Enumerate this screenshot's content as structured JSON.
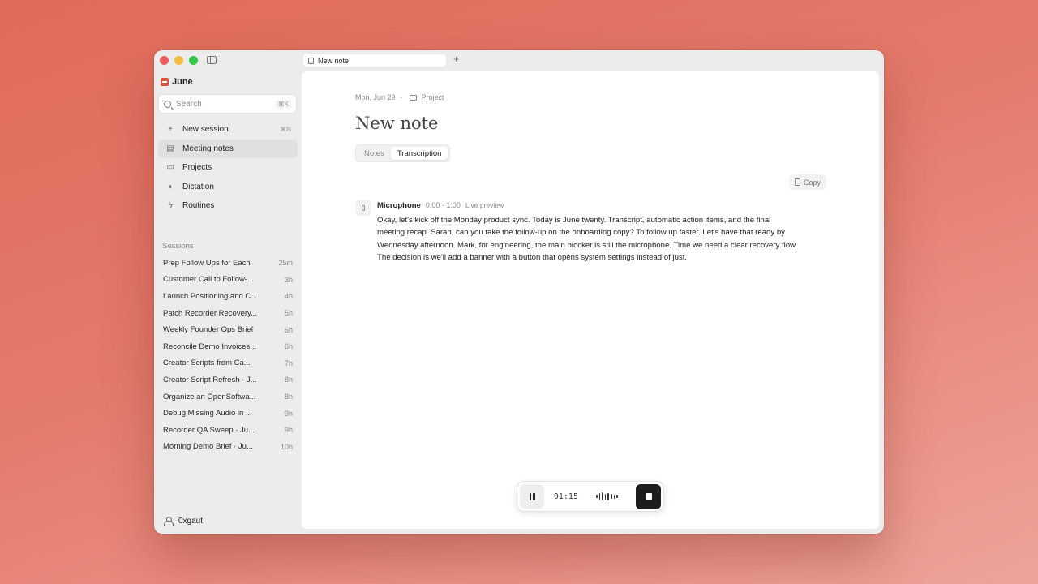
{
  "app": {
    "name": "June"
  },
  "tabs": [
    {
      "label": "New note"
    }
  ],
  "search": {
    "placeholder": "Search",
    "shortcut": "⌘K"
  },
  "nav": [
    {
      "label": "New session",
      "icon": "plus-icon",
      "shortcut": "⌘N",
      "active": false
    },
    {
      "label": "Meeting notes",
      "icon": "notes-icon",
      "active": true
    },
    {
      "label": "Projects",
      "icon": "folder-icon",
      "active": false
    },
    {
      "label": "Dictation",
      "icon": "mic-icon",
      "active": false
    },
    {
      "label": "Routines",
      "icon": "bolt-icon",
      "active": false
    }
  ],
  "sessions": {
    "label": "Sessions",
    "items": [
      {
        "title": "Prep Follow Ups for Each",
        "time": "25m"
      },
      {
        "title": "Customer Call to Follow-...",
        "time": "3h"
      },
      {
        "title": "Launch Positioning and C...",
        "time": "4h"
      },
      {
        "title": "Patch Recorder Recovery...",
        "time": "5h"
      },
      {
        "title": "Weekly Founder Ops Brief",
        "time": "6h"
      },
      {
        "title": "Reconcile Demo Invoices...",
        "time": "6h"
      },
      {
        "title": "Creator Scripts from Ca...",
        "time": "7h"
      },
      {
        "title": "Creator Script Refresh · J...",
        "time": "8h"
      },
      {
        "title": "Organize an OpenSoftwa...",
        "time": "8h"
      },
      {
        "title": "Debug Missing Audio in ...",
        "time": "9h"
      },
      {
        "title": "Recorder QA Sweep · Ju...",
        "time": "9h"
      },
      {
        "title": "Morning Demo Brief · Ju...",
        "time": "10h"
      }
    ]
  },
  "user": {
    "name": "0xgaut"
  },
  "note": {
    "date": "Mon, Jun 29",
    "separator": "·",
    "project": "Project",
    "title": "New note",
    "view_tabs": [
      {
        "label": "Notes",
        "active": false
      },
      {
        "label": "Transcription",
        "active": true
      }
    ],
    "copy_label": "Copy"
  },
  "transcript": {
    "speaker": "Microphone",
    "time_range": "0:00 · 1:00",
    "status": "Live preview",
    "text": "Okay, let's kick off the Monday product sync. Today is June twenty. Transcript, automatic action items, and the final meeting recap. Sarah, can you take the follow-up on the onboarding copy? To follow up faster. Let's have that ready by Wednesday afternoon. Mark, for engineering, the main blocker is still the microphone. Time we need a clear recovery flow. The decision is we'll add a banner with a button that opens system settings instead of just."
  },
  "player": {
    "elapsed": "01:15",
    "wave_levels": [
      0.35,
      0.7,
      0.9,
      0.6,
      0.8,
      0.5,
      0.45,
      0.4,
      0.35
    ]
  },
  "colors": {
    "background": "#e47a6c",
    "brand": "#d9533d",
    "stop_button": "#1d1d1d"
  }
}
